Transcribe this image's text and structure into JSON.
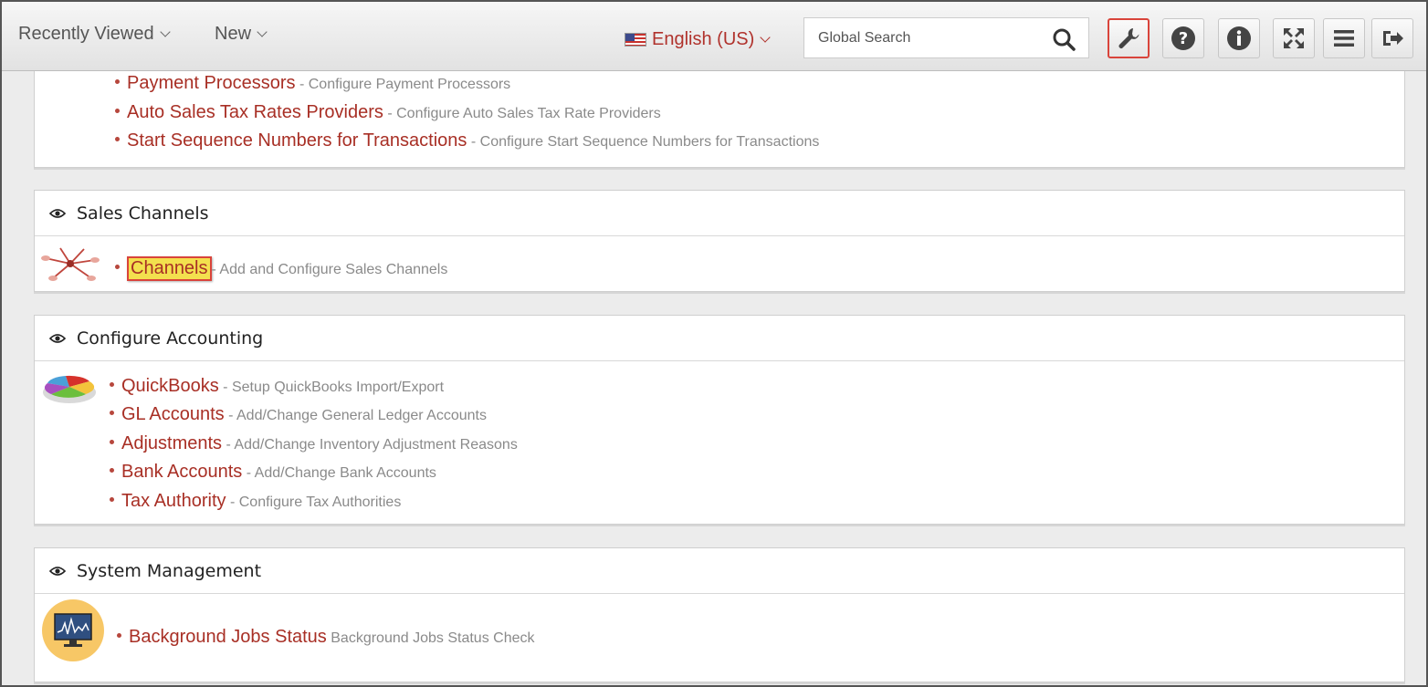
{
  "topbar": {
    "recently_viewed": "Recently Viewed",
    "new": "New",
    "language": "English (US)",
    "search_placeholder": "Global Search"
  },
  "top_panel": {
    "items": [
      {
        "link": "Payment Processors",
        "desc": "- Configure Payment Processors"
      },
      {
        "link": "Auto Sales Tax Rates Providers",
        "desc": "- Configure Auto Sales Tax Rate Providers"
      },
      {
        "link": "Start Sequence Numbers for Transactions",
        "desc": "- Configure Start Sequence Numbers for Transactions"
      }
    ]
  },
  "sales_channels": {
    "title": "Sales Channels",
    "items": [
      {
        "link": "Channels",
        "desc": "- Add and Configure Sales Channels"
      }
    ]
  },
  "accounting": {
    "title": "Configure Accounting",
    "items": [
      {
        "link": "QuickBooks",
        "desc": "- Setup QuickBooks Import/Export"
      },
      {
        "link": "GL Accounts",
        "desc": "- Add/Change General Ledger Accounts"
      },
      {
        "link": "Adjustments",
        "desc": "- Add/Change Inventory Adjustment Reasons"
      },
      {
        "link": "Bank Accounts",
        "desc": "- Add/Change Bank Accounts"
      },
      {
        "link": "Tax Authority",
        "desc": "- Configure Tax Authorities"
      }
    ]
  },
  "system": {
    "title": "System Management",
    "items": [
      {
        "link": "Background Jobs Status",
        "desc": "Background Jobs Status Check"
      }
    ]
  },
  "icons": {
    "search": "search-icon",
    "wrench": "wrench-icon",
    "help": "question-icon",
    "info": "info-icon",
    "fullscreen": "expand-icon",
    "menu": "menu-icon",
    "logout": "logout-icon"
  },
  "colors": {
    "link": "#a82f25",
    "highlight": "#f3e04e",
    "active_border": "#d9443b"
  }
}
